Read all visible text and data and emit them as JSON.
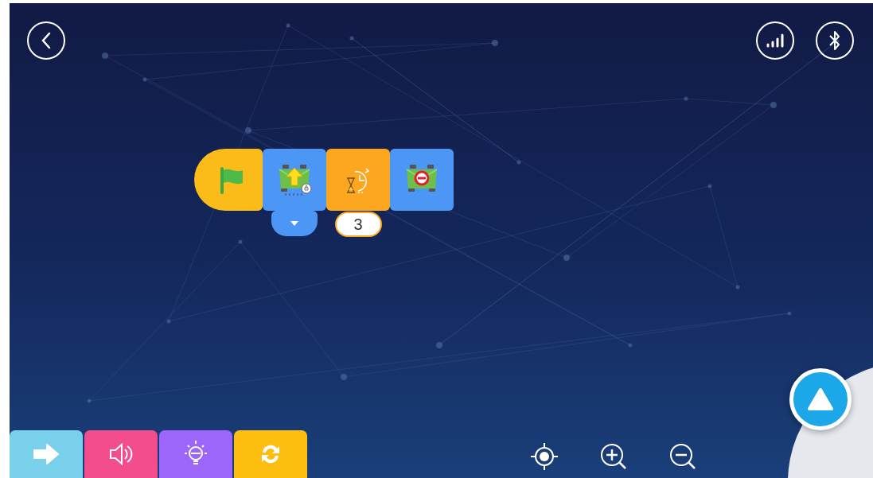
{
  "program_blocks": [
    {
      "kind": "start",
      "color": "#fbbc1a"
    },
    {
      "kind": "move",
      "color": "#4c97f5",
      "has_dropdown": true
    },
    {
      "kind": "wait",
      "color": "#fda620",
      "value": "3"
    },
    {
      "kind": "stop",
      "color": "#4c97f5"
    }
  ],
  "palette": [
    {
      "kind": "motion",
      "color": "#79d0ea"
    },
    {
      "kind": "sound",
      "color": "#f44d8e"
    },
    {
      "kind": "light",
      "color": "#9c66fb"
    },
    {
      "kind": "control",
      "color": "#fdbe0f"
    }
  ]
}
